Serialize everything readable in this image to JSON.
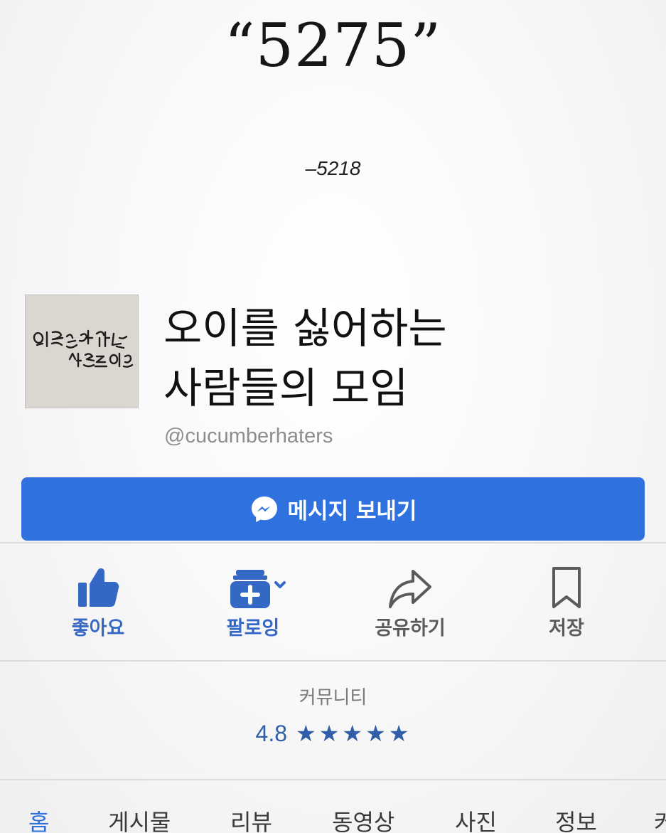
{
  "quote": {
    "title": "“5275”",
    "attribution": "–5218"
  },
  "profile": {
    "thumbnail_text": [
      "오이를 싫어하는",
      "사람들의모임"
    ],
    "name_line1": "오이를 싫어하는",
    "name_line2": "사람들의 모임",
    "handle": "@cucumberhaters"
  },
  "message_button": {
    "label": "메시지 보내기",
    "icon": "messenger-icon",
    "color": "#2f71df"
  },
  "actions": [
    {
      "label": "좋아요",
      "icon": "thumbs-up-icon",
      "color": "#3567c4"
    },
    {
      "label": "팔로잉",
      "icon": "follow-plus-icon",
      "color": "#3567c4"
    },
    {
      "label": "공유하기",
      "icon": "share-arrow-icon",
      "color": "#5b5b5b"
    },
    {
      "label": "저장",
      "icon": "bookmark-icon",
      "color": "#5b5b5b"
    }
  ],
  "community": {
    "label": "커뮤니티",
    "rating": "4.8",
    "stars": 5,
    "stars_text": "★"
  },
  "tabs": [
    {
      "label": "홈",
      "active": true
    },
    {
      "label": "게시물"
    },
    {
      "label": "리뷰"
    },
    {
      "label": "동영상"
    },
    {
      "label": "사진"
    },
    {
      "label": "정보"
    },
    {
      "label": "커"
    }
  ]
}
